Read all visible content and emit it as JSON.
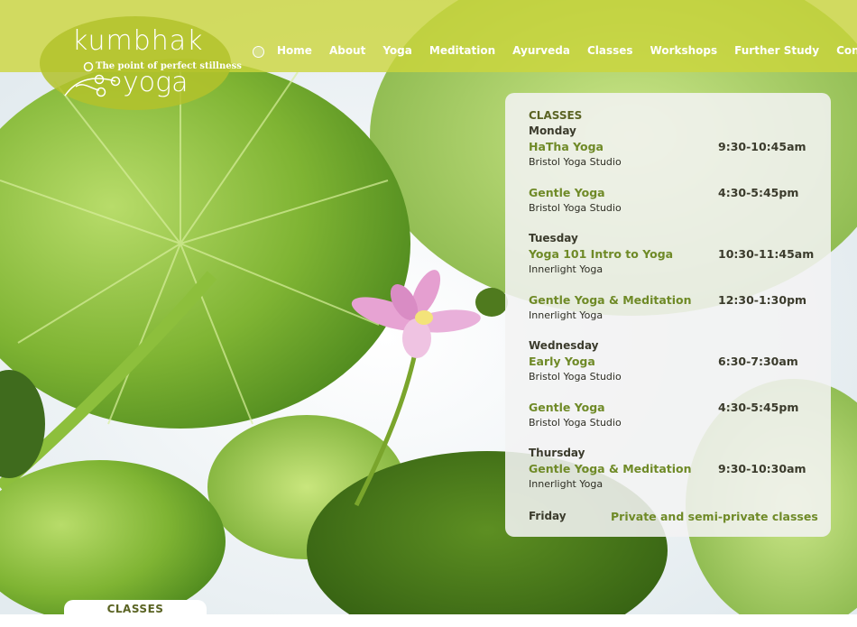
{
  "logo": {
    "word1": "kumbhak",
    "tagline": "The point of perfect stillness",
    "word2": "yoga"
  },
  "nav": {
    "items": [
      "Home",
      "About",
      "Yoga",
      "Meditation",
      "Ayurveda",
      "Classes",
      "Workshops",
      "Further Study",
      "Contact"
    ]
  },
  "schedule": {
    "heading": "CLASSES",
    "days": [
      {
        "day": "Monday",
        "classes": [
          {
            "name": "HaTha Yoga",
            "time": "9:30-10:45am",
            "location": "Bristol Yoga Studio"
          },
          {
            "name": "Gentle Yoga",
            "time": "4:30-5:45pm",
            "location": "Bristol Yoga Studio"
          }
        ]
      },
      {
        "day": "Tuesday",
        "classes": [
          {
            "name": "Yoga 101 Intro to Yoga",
            "time": "10:30-11:45am",
            "location": "Innerlight Yoga"
          },
          {
            "name": "Gentle Yoga & Meditation",
            "time": "12:30-1:30pm",
            "location": "Innerlight Yoga"
          }
        ]
      },
      {
        "day": "Wednesday",
        "classes": [
          {
            "name": "Early Yoga",
            "time": "6:30-7:30am",
            "location": "Bristol Yoga Studio"
          },
          {
            "name": "Gentle Yoga",
            "time": "4:30-5:45pm",
            "location": "Bristol Yoga Studio"
          }
        ]
      },
      {
        "day": "Thursday",
        "classes": [
          {
            "name": "Gentle Yoga & Meditation",
            "time": "9:30-10:30am",
            "location": "Innerlight Yoga"
          }
        ]
      }
    ],
    "friday": {
      "day": "Friday",
      "note": "Private and semi-private classes"
    }
  },
  "tab": {
    "label": "CLASSES"
  },
  "colors": {
    "leaf_green": "#7fae2a",
    "lime_bar": "#ccd63c",
    "class_name_green": "#6f8a27",
    "lotus_pink": "#e7a3d3",
    "sky": "#eef3f6"
  }
}
